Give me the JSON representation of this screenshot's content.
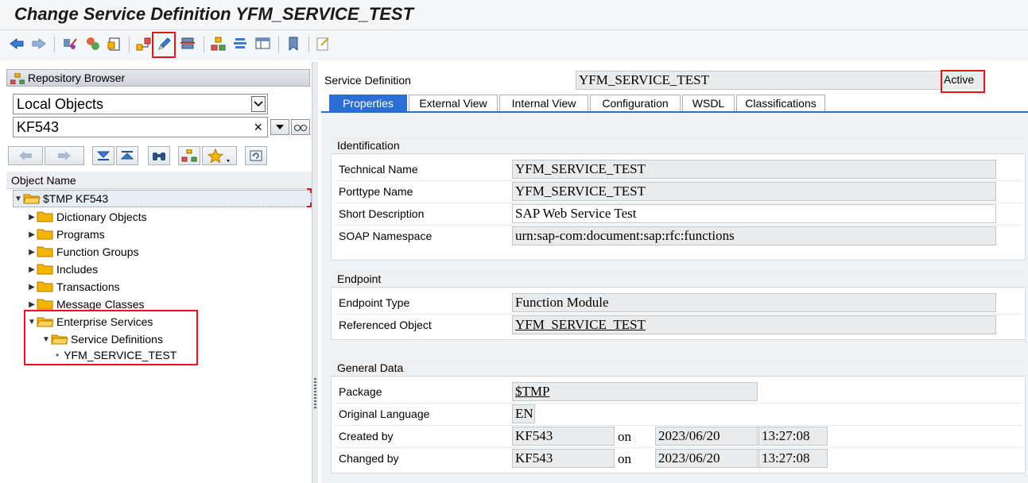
{
  "window": {
    "title": "Change Service Definition YFM_SERVICE_TEST"
  },
  "toolbar": {
    "icons": [
      "back-icon",
      "forward-icon",
      "display-change-icon",
      "active-inactive-icon",
      "object-list-icon",
      "hierarchy-icon",
      "edit-pencil-icon",
      "where-used-icon",
      "hierarchy-2-icon",
      "stack-icon",
      "layout-icon",
      "bookmark-icon",
      "info-icon"
    ]
  },
  "repository_browser": {
    "title": "Repository Browser",
    "object_type": "Local Objects",
    "search_value": "KF543",
    "clear_symbol": "×",
    "tree_header": "Object Name",
    "root": "$TMP KF543",
    "nodes": [
      {
        "label": "Dictionary Objects"
      },
      {
        "label": "Programs"
      },
      {
        "label": "Function Groups"
      },
      {
        "label": "Includes"
      },
      {
        "label": "Transactions"
      },
      {
        "label": "Message Classes"
      },
      {
        "label": "Enterprise Services"
      }
    ],
    "subnode": "Service Definitions",
    "leaf": "YFM_SERVICE_TEST",
    "leaf_bullet": "•"
  },
  "service_definition": {
    "label": "Service Definition",
    "value": "YFM_SERVICE_TEST",
    "status": "Active"
  },
  "tabs": [
    "Properties",
    "External View",
    "Internal View",
    "Configuration",
    "WSDL",
    "Classifications"
  ],
  "identification": {
    "title": "Identification",
    "technical_name_label": "Technical Name",
    "technical_name": "YFM_SERVICE_TEST",
    "porttype_label": "Porttype Name",
    "porttype": "YFM_SERVICE_TEST",
    "short_desc_label": "Short Description",
    "short_desc": "SAP Web Service Test",
    "soap_ns_label": "SOAP Namespace",
    "soap_ns": "urn:sap-com:document:sap:rfc:functions"
  },
  "endpoint": {
    "title": "Endpoint",
    "type_label": "Endpoint Type",
    "type": "Function Module",
    "ref_label": "Referenced Object",
    "ref": "YFM_SERVICE_TEST"
  },
  "general": {
    "title": "General Data",
    "package_label": "Package",
    "package": "$TMP",
    "lang_label": "Original Language",
    "lang": "EN",
    "created_label": "Created by",
    "created_user": "KF543",
    "created_on": "on",
    "created_date": "2023/06/20",
    "created_time": "13:27:08",
    "changed_label": "Changed by",
    "changed_user": "KF543",
    "changed_on": "on",
    "changed_date": "2023/06/20",
    "changed_time": "13:27:08"
  },
  "colors": {
    "accent": "#2a6ed6",
    "highlight": "#e0161c",
    "folder": "#f5b400"
  }
}
